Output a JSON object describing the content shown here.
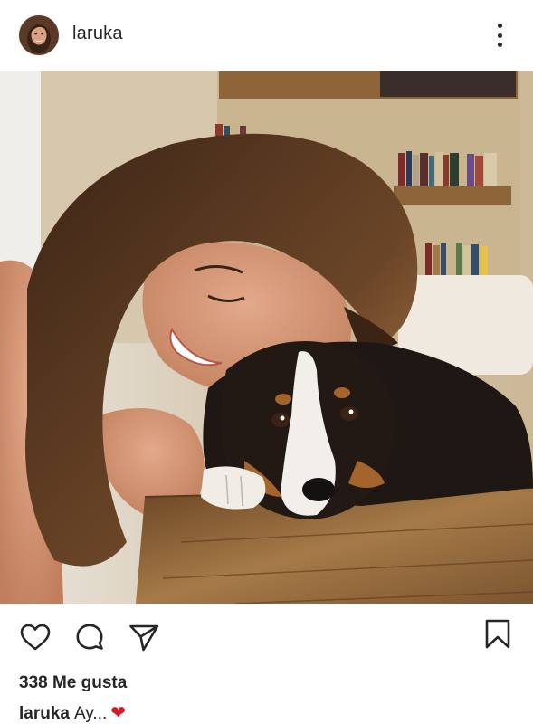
{
  "post": {
    "username": "laruka",
    "likes_text": "338 Me gusta",
    "caption_user": "laruka",
    "caption_text": "Ay...",
    "caption_emoji": "❤"
  },
  "icons": {
    "more": "more-vertical-icon",
    "like": "heart-icon",
    "comment": "comment-icon",
    "share": "send-icon",
    "save": "bookmark-icon"
  },
  "colors": {
    "text": "#262626",
    "heart_emoji": "#d7192c",
    "background": "#ffffff"
  }
}
